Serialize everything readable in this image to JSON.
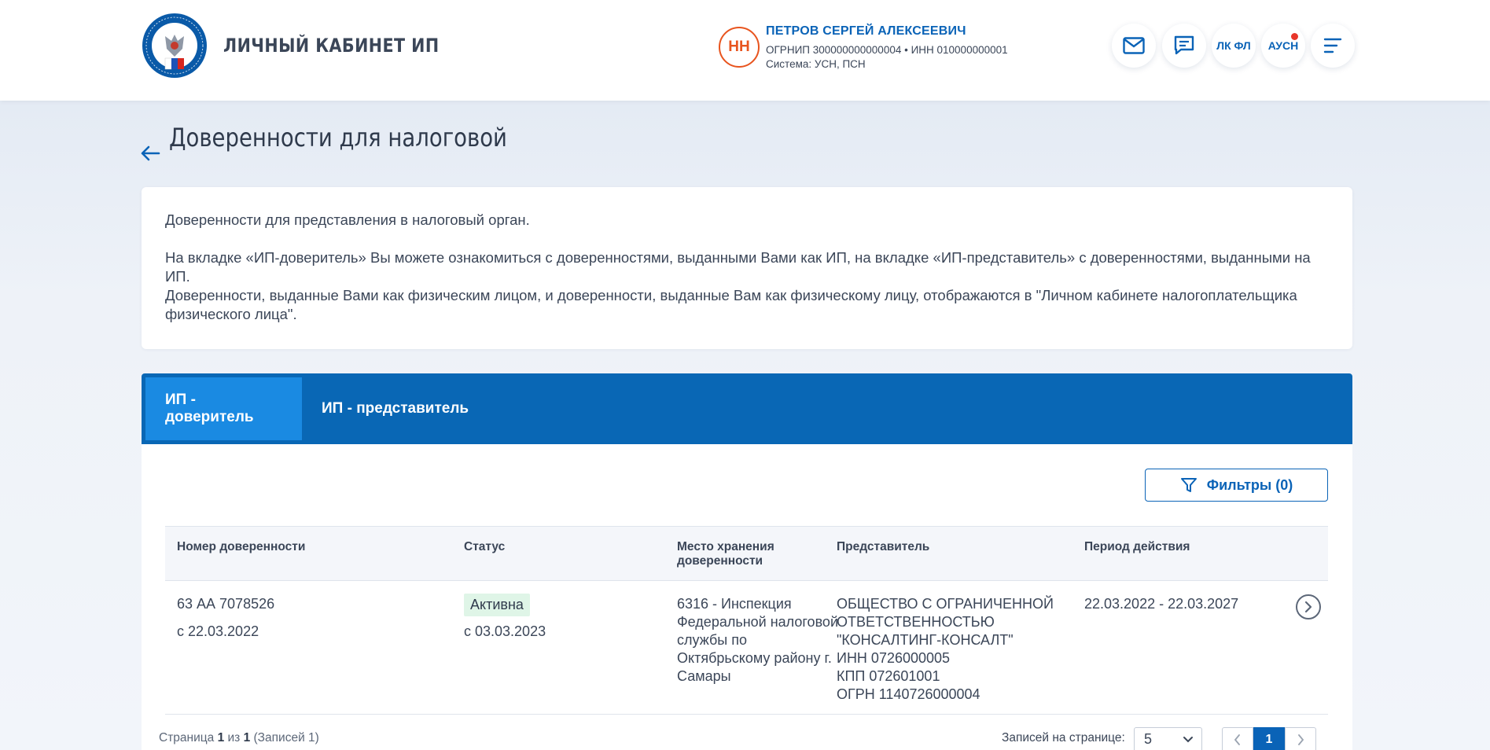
{
  "header": {
    "app_title": "ЛИЧНЫЙ КАБИНЕТ ИП",
    "logo_text": "ФЕДЕРАЛЬНАЯ НАЛОГОВАЯ СЛУЖБА",
    "user": {
      "initials": "НН",
      "name": "ПЕТРОВ СЕРГЕЙ АЛЕКСЕЕВИЧ",
      "ids": "ОГРНИП 300000000000004  •  ИНН 010000000001",
      "system": "Система: УСН, ПСН"
    },
    "buttons": {
      "lk_fl": "ЛК ФЛ",
      "ausn": "АУСН"
    }
  },
  "page": {
    "title": "Доверенности для налоговой"
  },
  "info": {
    "line1": "Доверенности для представления в налоговый орган.",
    "line2": "На вкладке «ИП-доверитель» Вы можете ознакомиться с доверенностями, выданными Вами как ИП, на вкладке «ИП-представитель» с доверенностями, выданными на ИП.",
    "line3": "Доверенности, выданные Вами как физическим лицом, и доверенности, выданные Вам как физическому лицу, отображаются в \"Личном кабинете налогоплательщика физического лица\"."
  },
  "tabs": [
    {
      "label": "ИП - доверитель",
      "active": true
    },
    {
      "label": "ИП - представитель",
      "active": false
    }
  ],
  "filters_label": "Фильтры (0)",
  "table": {
    "headers": [
      "Номер доверенности",
      "Статус",
      "Место хранения доверенности",
      "Представитель",
      "Период действия"
    ],
    "rows": [
      {
        "number": "63 АА 7078526",
        "number_date": "с 22.03.2022",
        "status": "Активна",
        "status_date": "с 03.03.2023",
        "storage": "6316 - Инспекция Федеральной налоговой службы по Октябрьскому району г. Самары",
        "representative": "ОБЩЕСТВО С ОГРАНИЧЕННОЙ ОТВЕТСТВЕННОСТЬЮ \"КОНСАЛТИНГ-КОНСАЛТ\"",
        "inn": "ИНН 0726000005",
        "kpp": "КПП 072601001",
        "ogrn": "ОГРН 1140726000004",
        "period": "22.03.2022 - 22.03.2027"
      }
    ]
  },
  "pagination": {
    "page_word": "Страница",
    "current": "1",
    "of_word": "из",
    "total": "1",
    "records": "(Записей 1)",
    "per_page_label": "Записей на странице:",
    "per_page_value": "5"
  },
  "colors": {
    "brand_blue": "#0967b5",
    "active_tab": "#1a8ae2",
    "avatar_orange": "#e8541e",
    "status_green_bg": "#dff5e7"
  }
}
